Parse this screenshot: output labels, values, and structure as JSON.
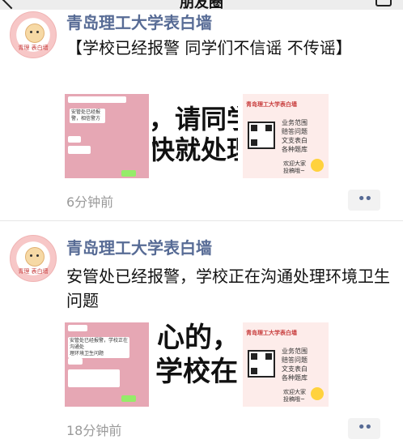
{
  "header": {
    "title": "朋友圈"
  },
  "posts": [
    {
      "author": "青岛理工大学表白墙",
      "text": "【学校已经报警 同学们不信谣 不传谣】",
      "time": "6分钟前",
      "thumbs": {
        "chat_lines": [
          "安管处已经报",
          "警，相信警方"
        ],
        "big_lines": [
          "，请同学",
          "快就处理"
        ],
        "poster_title": "青岛理工大学表白墙"
      }
    },
    {
      "author": "青岛理工大学表白墙",
      "text": "安管处已经报警，学校正在沟通处理环境卫生问题",
      "time": "18分钟前",
      "thumbs": {
        "chat_lines": [
          "安管处已经报警，学校正在沟通处",
          "理环境卫生问题"
        ],
        "big_lines": [
          "心的，",
          "学校在"
        ],
        "poster_title": "青岛理工大学表白墙"
      }
    }
  ],
  "poster": {
    "list": [
      "业务范围",
      "赔答问题",
      "文支表白",
      "各种题库"
    ],
    "foot": [
      "欢迎大家",
      "投稿哦~"
    ]
  },
  "avatar_text": "青理 表白墙",
  "more_label": "••"
}
